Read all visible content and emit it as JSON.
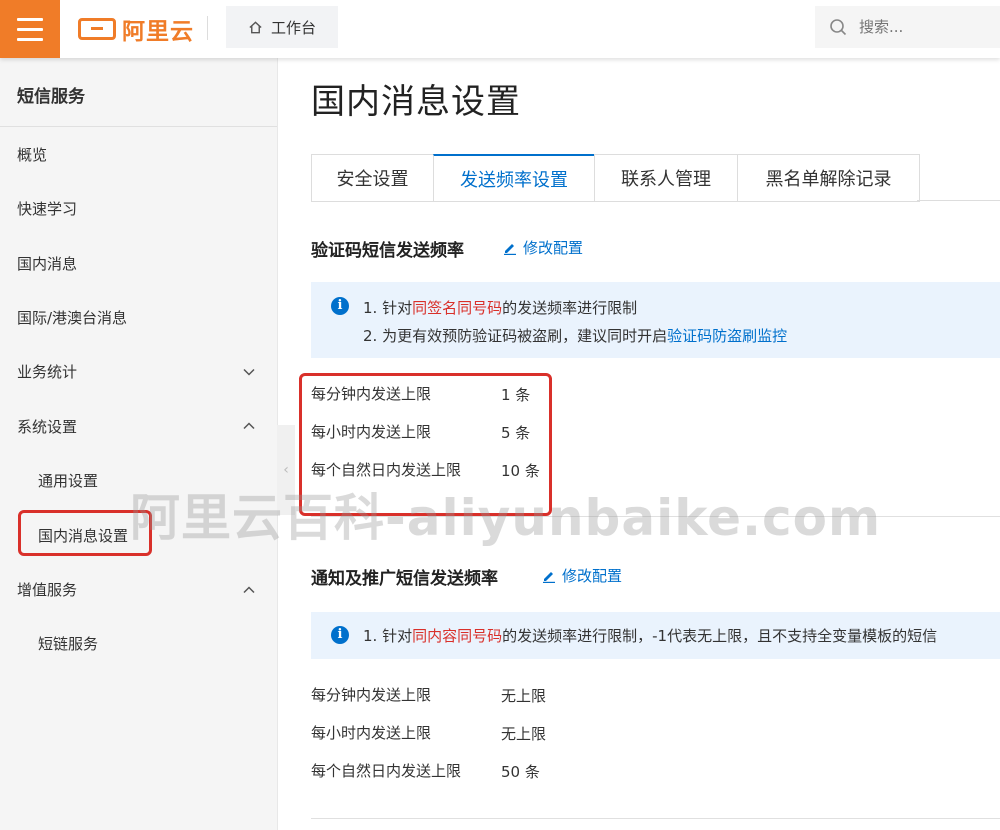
{
  "topbar": {
    "logo_text": "阿里云",
    "workbench_label": "工作台",
    "search_placeholder": "搜索..."
  },
  "sidebar": {
    "title": "短信服务",
    "items": {
      "overview": "概览",
      "quick_learn": "快速学习",
      "domestic": "国内消息",
      "intl": "国际/港澳台消息",
      "stats": "业务统计",
      "system": "系统设置",
      "general": "通用设置",
      "domestic_settings": "国内消息设置",
      "value_added": "增值服务",
      "short_link": "短链服务"
    }
  },
  "main": {
    "title": "国内消息设置",
    "tabs": [
      "安全设置",
      "发送频率设置",
      "联系人管理",
      "黑名单解除记录"
    ],
    "active_tab": "发送频率设置"
  },
  "verify_section": {
    "title": "验证码短信发送频率",
    "edit_label": "修改配置",
    "info_line1_prefix": "1. 针对",
    "info_line1_red": "同签名同号码",
    "info_line1_suffix": "的发送频率进行限制",
    "info_line2_prefix": "2. 为更有效预防验证码被盗刷，建议同时开启",
    "info_line2_link": "验证码防盗刷监控",
    "rows": [
      {
        "label": "每分钟内发送上限",
        "value": "1 条"
      },
      {
        "label": "每小时内发送上限",
        "value": "5 条"
      },
      {
        "label": "每个自然日内发送上限",
        "value": "10 条"
      }
    ]
  },
  "notify_section": {
    "title": "通知及推广短信发送频率",
    "edit_label": "修改配置",
    "info_line1_prefix": "1. 针对",
    "info_line1_red": "同内容同号码",
    "info_line1_suffix": "的发送频率进行限制，-1代表无上限，且不支持全变量模板的短信",
    "rows": [
      {
        "label": "每分钟内发送上限",
        "value": "无上限"
      },
      {
        "label": "每小时内发送上限",
        "value": "无上限"
      },
      {
        "label": "每个自然日内发送上限",
        "value": "50 条"
      }
    ]
  },
  "watermark": "阿里云百科-aliyunbaike.com",
  "colors": {
    "brand_orange": "#f07c28",
    "link_blue": "#0070cc",
    "highlight_red": "#d9302a",
    "info_bg": "#eaf3fd"
  }
}
